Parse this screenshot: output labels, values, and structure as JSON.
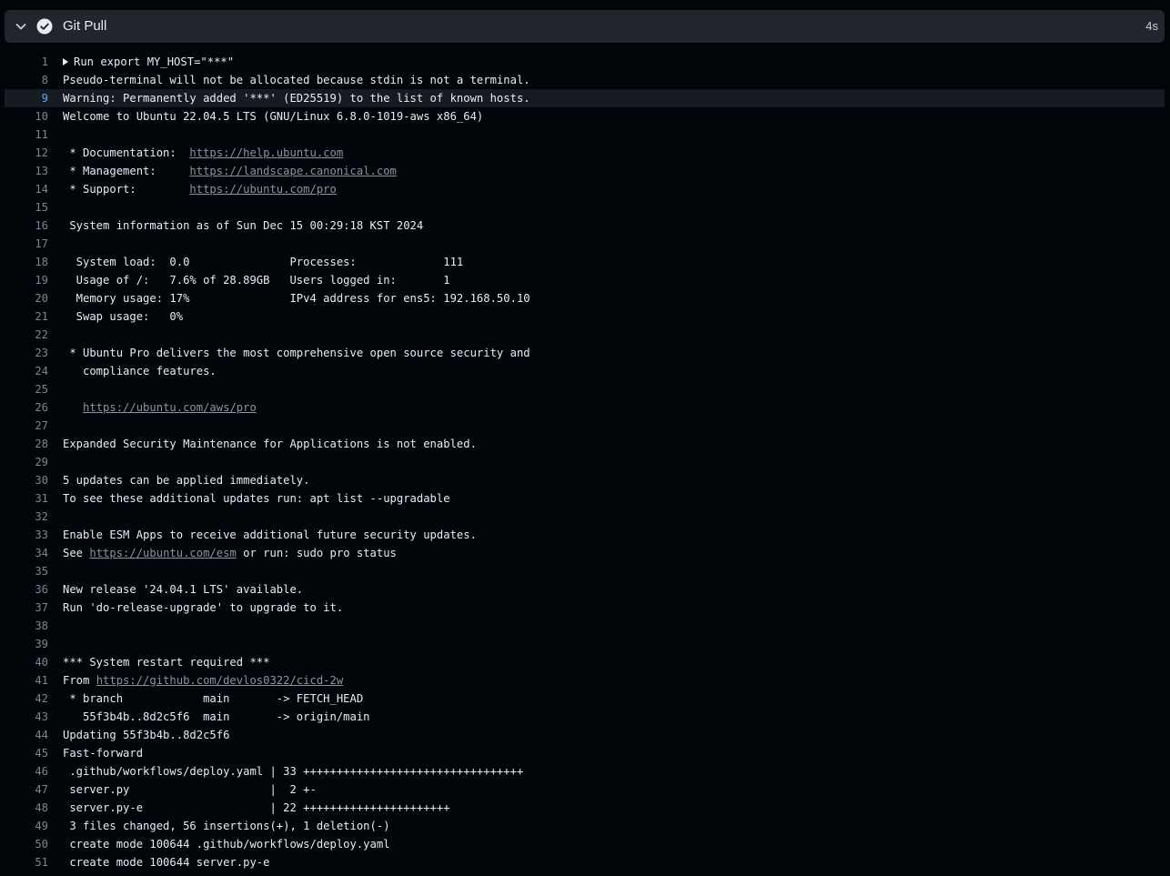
{
  "step": {
    "title": "Git Pull",
    "duration": "4s",
    "status_icon": "check-circle-icon",
    "toggle_icon": "chevron-down-icon"
  },
  "log_lines": [
    {
      "n": "1",
      "segments": [
        {
          "t": "Run export MY_HOST=\"***\""
        }
      ],
      "expandable": true
    },
    {
      "n": "8",
      "segments": [
        {
          "t": "Pseudo-terminal will not be allocated because stdin is not a terminal."
        }
      ]
    },
    {
      "n": "9",
      "segments": [
        {
          "t": "Warning: Permanently added '***' (ED25519) to the list of known hosts."
        }
      ],
      "highlight": true
    },
    {
      "n": "10",
      "segments": [
        {
          "t": "Welcome to Ubuntu 22.04.5 LTS (GNU/Linux 6.8.0-1019-aws x86_64)"
        }
      ]
    },
    {
      "n": "11",
      "segments": [
        {
          "t": ""
        }
      ]
    },
    {
      "n": "12",
      "segments": [
        {
          "t": " * Documentation:  "
        },
        {
          "t": "https://help.ubuntu.com",
          "link": true
        }
      ]
    },
    {
      "n": "13",
      "segments": [
        {
          "t": " * Management:     "
        },
        {
          "t": "https://landscape.canonical.com",
          "link": true
        }
      ]
    },
    {
      "n": "14",
      "segments": [
        {
          "t": " * Support:        "
        },
        {
          "t": "https://ubuntu.com/pro",
          "link": true
        }
      ]
    },
    {
      "n": "15",
      "segments": [
        {
          "t": ""
        }
      ]
    },
    {
      "n": "16",
      "segments": [
        {
          "t": " System information as of Sun Dec 15 00:29:18 KST 2024"
        }
      ]
    },
    {
      "n": "17",
      "segments": [
        {
          "t": ""
        }
      ]
    },
    {
      "n": "18",
      "segments": [
        {
          "t": "  System load:  0.0               Processes:             111"
        }
      ]
    },
    {
      "n": "19",
      "segments": [
        {
          "t": "  Usage of /:   7.6% of 28.89GB   Users logged in:       1"
        }
      ]
    },
    {
      "n": "20",
      "segments": [
        {
          "t": "  Memory usage: 17%               IPv4 address for ens5: 192.168.50.10"
        }
      ]
    },
    {
      "n": "21",
      "segments": [
        {
          "t": "  Swap usage:   0%"
        }
      ]
    },
    {
      "n": "22",
      "segments": [
        {
          "t": ""
        }
      ]
    },
    {
      "n": "23",
      "segments": [
        {
          "t": " * Ubuntu Pro delivers the most comprehensive open source security and"
        }
      ]
    },
    {
      "n": "24",
      "segments": [
        {
          "t": "   compliance features."
        }
      ]
    },
    {
      "n": "25",
      "segments": [
        {
          "t": ""
        }
      ]
    },
    {
      "n": "26",
      "segments": [
        {
          "t": "   "
        },
        {
          "t": "https://ubuntu.com/aws/pro",
          "link": true
        }
      ]
    },
    {
      "n": "27",
      "segments": [
        {
          "t": ""
        }
      ]
    },
    {
      "n": "28",
      "segments": [
        {
          "t": "Expanded Security Maintenance for Applications is not enabled."
        }
      ]
    },
    {
      "n": "29",
      "segments": [
        {
          "t": ""
        }
      ]
    },
    {
      "n": "30",
      "segments": [
        {
          "t": "5 updates can be applied immediately."
        }
      ]
    },
    {
      "n": "31",
      "segments": [
        {
          "t": "To see these additional updates run: apt list --upgradable"
        }
      ]
    },
    {
      "n": "32",
      "segments": [
        {
          "t": ""
        }
      ]
    },
    {
      "n": "33",
      "segments": [
        {
          "t": "Enable ESM Apps to receive additional future security updates."
        }
      ]
    },
    {
      "n": "34",
      "segments": [
        {
          "t": "See "
        },
        {
          "t": "https://ubuntu.com/esm",
          "link": true
        },
        {
          "t": " or run: sudo pro status"
        }
      ]
    },
    {
      "n": "35",
      "segments": [
        {
          "t": ""
        }
      ]
    },
    {
      "n": "36",
      "segments": [
        {
          "t": "New release '24.04.1 LTS' available."
        }
      ]
    },
    {
      "n": "37",
      "segments": [
        {
          "t": "Run 'do-release-upgrade' to upgrade to it."
        }
      ]
    },
    {
      "n": "38",
      "segments": [
        {
          "t": ""
        }
      ]
    },
    {
      "n": "39",
      "segments": [
        {
          "t": ""
        }
      ]
    },
    {
      "n": "40",
      "segments": [
        {
          "t": "*** System restart required ***"
        }
      ]
    },
    {
      "n": "41",
      "segments": [
        {
          "t": "From "
        },
        {
          "t": "https://github.com/devlos0322/cicd-2w",
          "link": true
        }
      ]
    },
    {
      "n": "42",
      "segments": [
        {
          "t": " * branch            main       -> FETCH_HEAD"
        }
      ]
    },
    {
      "n": "43",
      "segments": [
        {
          "t": "   55f3b4b..8d2c5f6  main       -> origin/main"
        }
      ]
    },
    {
      "n": "44",
      "segments": [
        {
          "t": "Updating 55f3b4b..8d2c5f6"
        }
      ]
    },
    {
      "n": "45",
      "segments": [
        {
          "t": "Fast-forward"
        }
      ]
    },
    {
      "n": "46",
      "segments": [
        {
          "t": " .github/workflows/deploy.yaml | 33 +++++++++++++++++++++++++++++++++"
        }
      ]
    },
    {
      "n": "47",
      "segments": [
        {
          "t": " server.py                     |  2 +-"
        }
      ]
    },
    {
      "n": "48",
      "segments": [
        {
          "t": " server.py-e                   | 22 ++++++++++++++++++++++"
        }
      ]
    },
    {
      "n": "49",
      "segments": [
        {
          "t": " 3 files changed, 56 insertions(+), 1 deletion(-)"
        }
      ]
    },
    {
      "n": "50",
      "segments": [
        {
          "t": " create mode 100644 .github/workflows/deploy.yaml"
        }
      ]
    },
    {
      "n": "51",
      "segments": [
        {
          "t": " create mode 100644 server.py-e"
        }
      ]
    }
  ]
}
